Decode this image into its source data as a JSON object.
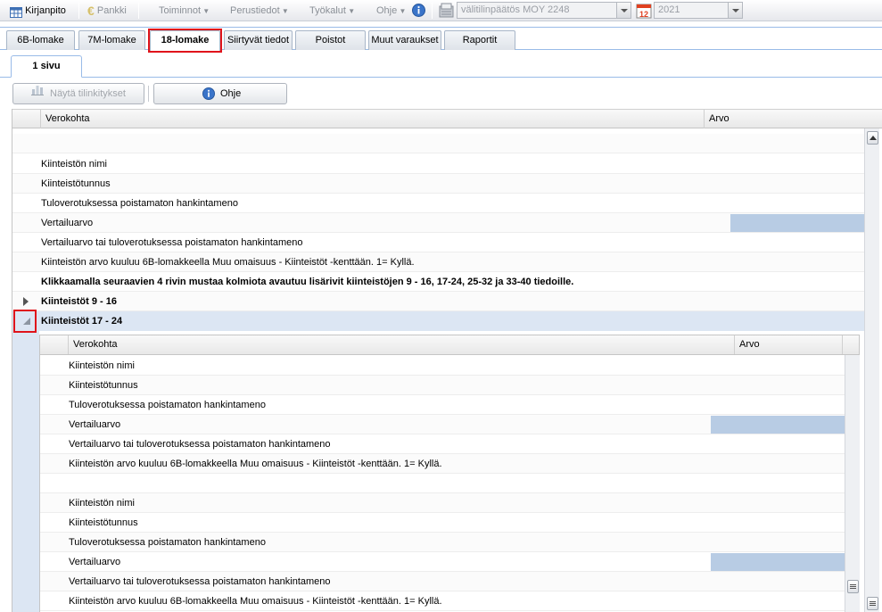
{
  "menubar": {
    "kirjanpito": "Kirjanpito",
    "pankki": "Pankki",
    "toiminnot": "Toiminnot",
    "perustiedot": "Perustiedot",
    "tyokalut": "Työkalut",
    "ohje": "Ohje",
    "report_select_value": "välitilinpäätös MOY 2248",
    "year_select_value": "2021",
    "calendar_icon_label": "12"
  },
  "tabs": [
    {
      "label": "6B-lomake"
    },
    {
      "label": "7M-lomake"
    },
    {
      "label": "18-lomake"
    },
    {
      "label": "Siirtyvät tiedot"
    },
    {
      "label": "Poistot"
    },
    {
      "label": "Muut varaukset"
    },
    {
      "label": "Raportit"
    }
  ],
  "subtab": {
    "label": "1 sivu"
  },
  "toolbar": {
    "show_links_label": "Näytä tilinkitykset",
    "help_label": "Ohje"
  },
  "grid": {
    "columns": {
      "verokohta": "Verokohta",
      "arvo": "Arvo"
    },
    "rows": [
      {
        "text": ""
      },
      {
        "text": "Kiinteistön nimi"
      },
      {
        "text": "Kiinteistötunnus"
      },
      {
        "text": "Tuloverotuksessa poistamaton hankintameno"
      },
      {
        "text": "Vertailuarvo"
      },
      {
        "text": "Vertailuarvo tai tuloverotuksessa poistamaton hankintameno"
      },
      {
        "text": "Kiinteistön arvo kuuluu 6B-lomakkeella Muu omaisuus - Kiinteistöt -kenttään. 1= Kyllä."
      },
      {
        "text": "Klikkaamalla seuraavien 4 rivin mustaa kolmiota avautuu lisärivit kiinteistöjen 9 - 16, 17-24, 25-32 ja 33-40 tiedoille."
      }
    ],
    "group_collapsed": "Kiinteistöt 9 - 16",
    "group_expanded": "Kiinteistöt 17 - 24",
    "nested": {
      "columns": {
        "verokohta": "Verokohta",
        "arvo": "Arvo"
      },
      "rows": [
        {
          "text": "Kiinteistön nimi"
        },
        {
          "text": "Kiinteistötunnus"
        },
        {
          "text": "Tuloverotuksessa poistamaton hankintameno"
        },
        {
          "text": "Vertailuarvo"
        },
        {
          "text": "Vertailuarvo tai tuloverotuksessa poistamaton hankintameno"
        },
        {
          "text": "Kiinteistön arvo kuuluu 6B-lomakkeella Muu omaisuus - Kiinteistöt -kenttään. 1= Kyllä."
        },
        {
          "text": ""
        },
        {
          "text": "Kiinteistön nimi"
        },
        {
          "text": "Kiinteistötunnus"
        },
        {
          "text": "Tuloverotuksessa poistamaton hankintameno"
        },
        {
          "text": "Vertailuarvo"
        },
        {
          "text": "Vertailuarvo tai tuloverotuksessa poistamaton hankintameno"
        },
        {
          "text": "Kiinteistön arvo kuuluu 6B-lomakkeella Muu omaisuus - Kiinteistöt -kenttään. 1= Kyllä."
        }
      ]
    }
  },
  "colors": {
    "accent_border": "#99bbe8",
    "value_cell": "#b8cce4",
    "highlight_box": "#e0141b",
    "expanded_row_bg": "#dce6f3"
  }
}
